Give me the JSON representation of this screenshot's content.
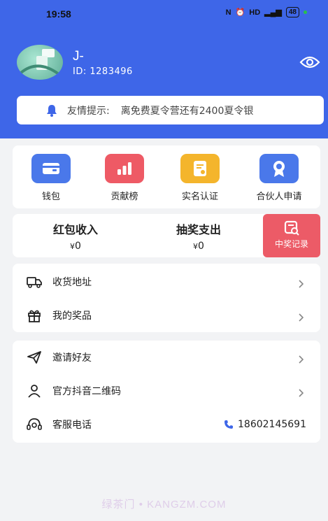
{
  "status_bar": {
    "time": "19:58",
    "battery": "48"
  },
  "profile": {
    "name": "J-",
    "id_label": "ID:",
    "id_value": "1283496"
  },
  "notice": {
    "label": "友情提示:",
    "text": "离免费夏令营还有2400夏令银"
  },
  "quick_actions": [
    {
      "label": "钱包",
      "icon": "wallet-icon",
      "color": "#4a78ea"
    },
    {
      "label": "贡献榜",
      "icon": "bar-chart-icon",
      "color": "#ee5a65"
    },
    {
      "label": "实名认证",
      "icon": "certificate-icon",
      "color": "#f4b52c"
    },
    {
      "label": "合伙人申请",
      "icon": "badge-icon",
      "color": "#4a78ea"
    }
  ],
  "finance": {
    "income_label": "红包收入",
    "income_currency": "¥",
    "income_value": "0",
    "expense_label": "抽奖支出",
    "expense_currency": "¥",
    "expense_value": "0",
    "record_label": "中奖记录",
    "record_color": "#ec5b67"
  },
  "menu1": [
    {
      "label": "收货地址",
      "icon": "truck-icon"
    },
    {
      "label": "我的奖品",
      "icon": "gift-icon"
    }
  ],
  "menu2": [
    {
      "label": "邀请好友",
      "icon": "paper-plane-icon"
    },
    {
      "label": "官方抖音二维码",
      "icon": "user-icon"
    },
    {
      "label": "客服电话",
      "icon": "headset-icon",
      "phone": "18602145691"
    }
  ],
  "watermark": "绿茶门 • KANGZM.COM",
  "colors": {
    "header": "#3e66e8",
    "background": "#f2f3f5"
  }
}
